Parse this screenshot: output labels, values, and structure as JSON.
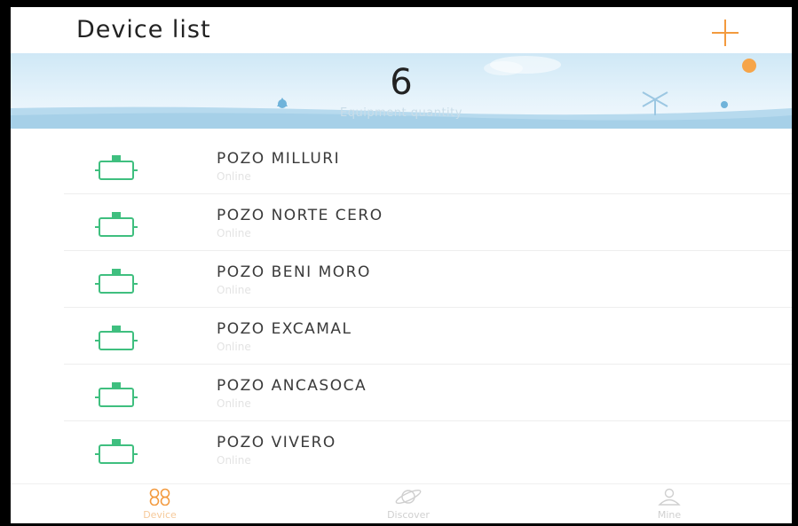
{
  "header": {
    "title": "Device list",
    "add_icon": "plus-icon"
  },
  "summary": {
    "count": "6",
    "label": "Equipment quantity"
  },
  "devices": [
    {
      "name": "POZO MILLURI",
      "status": "Online"
    },
    {
      "name": "POZO NORTE CERO",
      "status": "Online"
    },
    {
      "name": "POZO BENI MORO",
      "status": "Online"
    },
    {
      "name": "POZO EXCAMAL",
      "status": "Online"
    },
    {
      "name": "POZO ANCASOCA",
      "status": "Online"
    },
    {
      "name": "POZO VIVERO",
      "status": "Online"
    }
  ],
  "tabs": [
    {
      "label": "Device",
      "icon": "device-tab-icon",
      "active": true
    },
    {
      "label": "Discover",
      "icon": "planet-icon",
      "active": false
    },
    {
      "label": "Mine",
      "icon": "user-icon",
      "active": false
    }
  ],
  "colors": {
    "accent": "#f39a3e",
    "device_icon": "#3fbf7f",
    "banner": "#d6ecf8",
    "status_text": "#e3e3e3"
  }
}
